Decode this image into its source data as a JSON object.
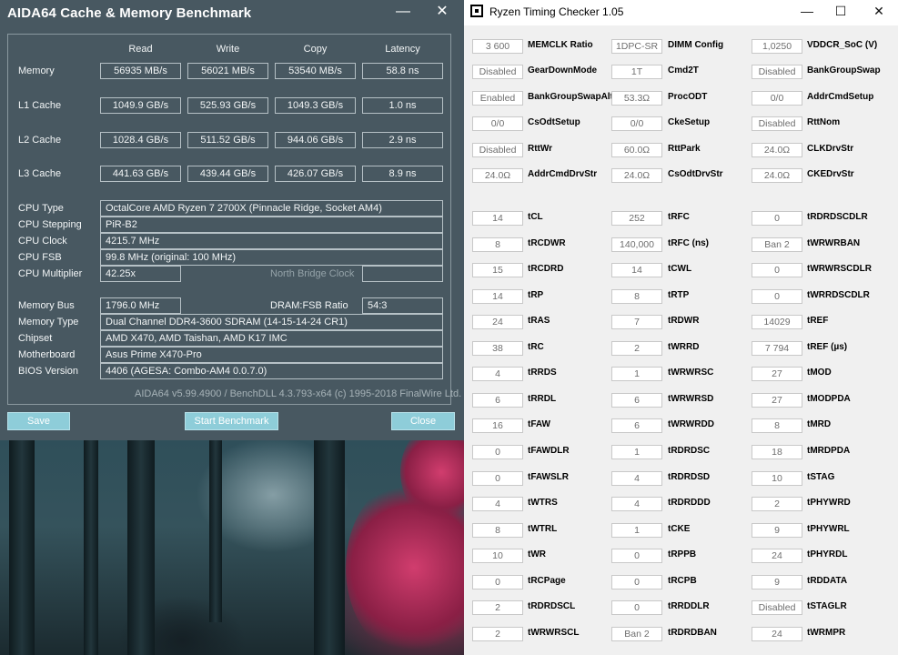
{
  "aida": {
    "title": "AIDA64 Cache & Memory Benchmark",
    "minimize": "—",
    "close": "✕",
    "headers": [
      "Read",
      "Write",
      "Copy",
      "Latency"
    ],
    "bench_rows": [
      {
        "label": "Memory",
        "read": "56935 MB/s",
        "write": "56021 MB/s",
        "copy": "53540 MB/s",
        "latency": "58.8 ns"
      },
      {
        "label": "L1 Cache",
        "read": "1049.9 GB/s",
        "write": "525.93 GB/s",
        "copy": "1049.3 GB/s",
        "latency": "1.0 ns"
      },
      {
        "label": "L2 Cache",
        "read": "1028.4 GB/s",
        "write": "511.52 GB/s",
        "copy": "944.06 GB/s",
        "latency": "2.9 ns"
      },
      {
        "label": "L3 Cache",
        "read": "441.63 GB/s",
        "write": "439.44 GB/s",
        "copy": "426.07 GB/s",
        "latency": "8.9 ns"
      }
    ],
    "info": {
      "cpu_type_label": "CPU Type",
      "cpu_type": "OctalCore AMD Ryzen 7 2700X  (Pinnacle Ridge, Socket AM4)",
      "cpu_stepping_label": "CPU Stepping",
      "cpu_stepping": "PiR-B2",
      "cpu_clock_label": "CPU Clock",
      "cpu_clock": "4215.7 MHz",
      "cpu_fsb_label": "CPU FSB",
      "cpu_fsb": "99.8 MHz  (original: 100 MHz)",
      "cpu_mult_label": "CPU Multiplier",
      "cpu_mult": "42.25x",
      "nb_clock_label": "North Bridge Clock",
      "mem_bus_label": "Memory Bus",
      "mem_bus": "1796.0 MHz",
      "dram_fsb_label": "DRAM:FSB Ratio",
      "dram_fsb": "54:3",
      "mem_type_label": "Memory Type",
      "mem_type": "Dual Channel DDR4-3600 SDRAM  (14-15-14-24 CR1)",
      "chipset_label": "Chipset",
      "chipset": "AMD X470, AMD Taishan, AMD K17 IMC",
      "mobo_label": "Motherboard",
      "mobo": "Asus Prime X470-Pro",
      "bios_label": "BIOS Version",
      "bios": "4406  (AGESA: Combo-AM4 0.0.7.0)"
    },
    "about": "AIDA64 v5.99.4900 / BenchDLL 4.3.793-x64  (c) 1995-2018 FinalWire Ltd.",
    "buttons": {
      "save": "Save",
      "start": "Start Benchmark",
      "close": "Close"
    }
  },
  "rtc": {
    "title": "Ryzen Timing Checker 1.05",
    "win_min": "—",
    "win_max": "☐",
    "win_close": "✕",
    "top_rows": [
      [
        [
          "3 600",
          "MEMCLK Ratio"
        ],
        [
          "1DPC-SR",
          "DIMM Config"
        ],
        [
          "1,0250",
          "VDDCR_SoC (V)"
        ]
      ],
      [
        [
          "Disabled",
          "GearDownMode"
        ],
        [
          "1T",
          "Cmd2T"
        ],
        [
          "Disabled",
          "BankGroupSwap"
        ]
      ],
      [
        [
          "Enabled",
          "BankGroupSwapAlt"
        ],
        [
          "53.3Ω",
          "ProcODT"
        ],
        [
          "0/0",
          "AddrCmdSetup"
        ]
      ],
      [
        [
          "0/0",
          "CsOdtSetup"
        ],
        [
          "0/0",
          "CkeSetup"
        ],
        [
          "Disabled",
          "RttNom"
        ]
      ],
      [
        [
          "Disabled",
          "RttWr"
        ],
        [
          "60.0Ω",
          "RttPark"
        ],
        [
          "24.0Ω",
          "CLKDrvStr"
        ]
      ],
      [
        [
          "24.0Ω",
          "AddrCmdDrvStr"
        ],
        [
          "24.0Ω",
          "CsOdtDrvStr"
        ],
        [
          "24.0Ω",
          "CKEDrvStr"
        ]
      ]
    ],
    "timing_rows": [
      [
        [
          "14",
          "tCL"
        ],
        [
          "252",
          "tRFC"
        ],
        [
          "0",
          "tRDRDSCDLR"
        ]
      ],
      [
        [
          "8",
          "tRCDWR"
        ],
        [
          "140,000",
          "tRFC (ns)"
        ],
        [
          "Ban 2",
          "tWRWRBAN"
        ]
      ],
      [
        [
          "15",
          "tRCDRD"
        ],
        [
          "14",
          "tCWL"
        ],
        [
          "0",
          "tWRWRSCDLR"
        ]
      ],
      [
        [
          "14",
          "tRP"
        ],
        [
          "8",
          "tRTP"
        ],
        [
          "0",
          "tWRRDSCDLR"
        ]
      ],
      [
        [
          "24",
          "tRAS"
        ],
        [
          "7",
          "tRDWR"
        ],
        [
          "14029",
          "tREF"
        ]
      ],
      [
        [
          "38",
          "tRC"
        ],
        [
          "2",
          "tWRRD"
        ],
        [
          "7 794",
          "tREF (µs)"
        ]
      ],
      [
        [
          "4",
          "tRRDS"
        ],
        [
          "1",
          "tWRWRSC"
        ],
        [
          "27",
          "tMOD"
        ]
      ],
      [
        [
          "6",
          "tRRDL"
        ],
        [
          "6",
          "tWRWRSD"
        ],
        [
          "27",
          "tMODPDA"
        ]
      ],
      [
        [
          "16",
          "tFAW"
        ],
        [
          "6",
          "tWRWRDD"
        ],
        [
          "8",
          "tMRD"
        ]
      ],
      [
        [
          "0",
          "tFAWDLR"
        ],
        [
          "1",
          "tRDRDSC"
        ],
        [
          "18",
          "tMRDPDA"
        ]
      ],
      [
        [
          "0",
          "tFAWSLR"
        ],
        [
          "4",
          "tRDRDSD"
        ],
        [
          "10",
          "tSTAG"
        ]
      ],
      [
        [
          "4",
          "tWTRS"
        ],
        [
          "4",
          "tRDRDDD"
        ],
        [
          "2",
          "tPHYWRD"
        ]
      ],
      [
        [
          "8",
          "tWTRL"
        ],
        [
          "1",
          "tCKE"
        ],
        [
          "9",
          "tPHYWRL"
        ]
      ],
      [
        [
          "10",
          "tWR"
        ],
        [
          "0",
          "tRPPB"
        ],
        [
          "24",
          "tPHYRDL"
        ]
      ],
      [
        [
          "0",
          "tRCPage"
        ],
        [
          "0",
          "tRCPB"
        ],
        [
          "9",
          "tRDDATA"
        ]
      ],
      [
        [
          "2",
          "tRDRDSCL"
        ],
        [
          "0",
          "tRRDDLR"
        ],
        [
          "Disabled",
          "tSTAGLR"
        ]
      ],
      [
        [
          "2",
          "tWRWRSCL"
        ],
        [
          "Ban 2",
          "tRDRDBAN"
        ],
        [
          "24",
          "tWRMPR"
        ]
      ]
    ]
  }
}
